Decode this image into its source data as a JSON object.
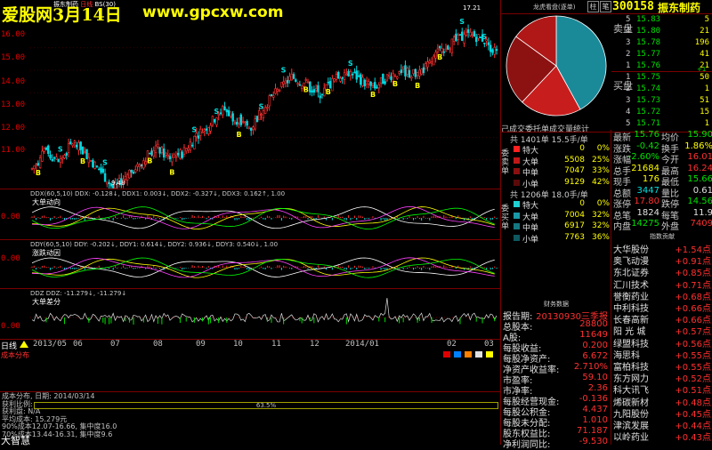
{
  "banner": {
    "site": "爱股网3月14日",
    "url": "www.gpcxw.com"
  },
  "chart_title": "振东制药",
  "chart_tag": "日线",
  "chart_sub": "BS(30)",
  "main_axis": [
    "16.00",
    "15.00",
    "14.00",
    "13.00",
    "12.00",
    "11.00"
  ],
  "price_labels": {
    "high": "17.21",
    "low": "9.48"
  },
  "ind1": {
    "header": "DDX(60,5,10)  DDX: -0.128↓, DDX1: 0.003↓, DDX2: -0.327↓, DDX3: 0.162↑, 1.00",
    "name": "大单动向",
    "axis": "0.00"
  },
  "ind2": {
    "header": "DDY(60,5,10)  DDY: -0.202↓, DDY1: 0.614↓, DDY2: 0.936↓, DDY3: 0.540↓, 1.00",
    "name": "涨跌动因",
    "axis": "0.00"
  },
  "ind3": {
    "header": "DDZ  DDZ: -11.279↓, -11.279↓",
    "name": "大单差分",
    "axis": "0.00"
  },
  "xaxis": [
    "2013/05",
    "06",
    "07",
    "08",
    "09",
    "10",
    "11",
    "12",
    "2014/01",
    "02",
    "03"
  ],
  "bottom_tabs": {
    "day": "日线",
    "cost": "成本分布"
  },
  "bottom_info": {
    "line1": "成本分布, 日期: 2014/03/14",
    "profit_label": "获利比例:",
    "profit_pct": "63.5%",
    "line3": "获利盘: N/A",
    "line4": "平均成本: 15.279元",
    "line5": "90%成本12.07-16.66, 集中度16.0",
    "line6": "70%成本13.44-16.31, 集中度9.6",
    "logo": "大智慧"
  },
  "right": {
    "tabs": [
      "龙虎看盘(逐单)",
      "柱",
      "笔"
    ],
    "code": "300158",
    "name": "振东制药",
    "pie_title": "己成交委托单成交量统计",
    "sell_side": "卖盘",
    "buy_side": "买盘",
    "sell_orders": [
      {
        "lv": "5",
        "price": "15.83",
        "vol": "5"
      },
      {
        "lv": "4",
        "price": "15.80",
        "vol": "21"
      },
      {
        "lv": "3",
        "price": "15.78",
        "vol": "196"
      },
      {
        "lv": "2",
        "price": "15.77",
        "vol": "41"
      },
      {
        "lv": "1",
        "price": "15.76",
        "vol": "21"
      }
    ],
    "buy_orders": [
      {
        "lv": "1",
        "price": "15.75",
        "vol": "50"
      },
      {
        "lv": "2",
        "price": "15.74",
        "vol": "1"
      },
      {
        "lv": "3",
        "price": "15.73",
        "vol": "51"
      },
      {
        "lv": "4",
        "price": "15.72",
        "vol": "15"
      },
      {
        "lv": "5",
        "price": "15.71",
        "vol": "1"
      }
    ],
    "sell_stats": {
      "header": "共 1401单 15.5手/单",
      "side": "委卖单",
      "rows": [
        {
          "label": "特大",
          "count": "0",
          "pct": "0%"
        },
        {
          "label": "大单",
          "count": "5508",
          "pct": "25%"
        },
        {
          "label": "中单",
          "count": "7047",
          "pct": "33%"
        },
        {
          "label": "小单",
          "count": "9129",
          "pct": "42%"
        }
      ]
    },
    "buy_stats": {
      "header": "共 1206单 18.0手/单",
      "side": "委买单",
      "rows": [
        {
          "label": "特大",
          "count": "0",
          "pct": "0%"
        },
        {
          "label": "大单",
          "count": "7004",
          "pct": "32%"
        },
        {
          "label": "中单",
          "count": "6917",
          "pct": "32%"
        },
        {
          "label": "小单",
          "count": "7763",
          "pct": "36%"
        }
      ]
    },
    "quote": [
      {
        "l1": "最新",
        "v1": "15.76",
        "l2": "均价",
        "v2": "15.90"
      },
      {
        "l1": "涨跌",
        "v1": "-0.42",
        "l2": "换手",
        "v2": "1.86%"
      },
      {
        "l1": "涨幅",
        "v1": "-2.60%",
        "l2": "今开",
        "v2": "16.01"
      },
      {
        "l1": "总手",
        "v1": "21684",
        "l2": "最高",
        "v2": "16.24"
      },
      {
        "l1": "现手",
        "v1": "176",
        "l2": "最低",
        "v2": "15.66"
      },
      {
        "l1": "总额",
        "v1": "3447",
        "l2": "量比",
        "v2": "0.61"
      },
      {
        "l1": "涨停",
        "v1": "17.80",
        "l2": "跌停",
        "v2": "14.56"
      },
      {
        "l1": "总笔",
        "v1": "1824",
        "l2": "每笔",
        "v2": "11.9"
      },
      {
        "l1": "内盘",
        "v1": "14275",
        "l2": "外盘",
        "v2": "7409"
      }
    ],
    "fin_title": "财务数据",
    "fin": [
      {
        "label": "报告期:",
        "value": "20130930三季报"
      },
      {
        "label": "总股本:",
        "value": "28800"
      },
      {
        "label": "A股:",
        "value": "11649"
      },
      {
        "label": "每股收益:",
        "value": "0.200"
      },
      {
        "label": "每股净资产:",
        "value": "6.672"
      },
      {
        "label": "净资产收益率:",
        "value": "2.710%"
      },
      {
        "label": "市盈率:",
        "value": "59.10"
      },
      {
        "label": "市净率:",
        "value": "2.36"
      },
      {
        "label": "每股经营现金:",
        "value": "-0.136"
      },
      {
        "label": "每股公积金:",
        "value": "4.437"
      },
      {
        "label": "每股未分配:",
        "value": "1.010"
      },
      {
        "label": "股东权益比:",
        "value": "71.187"
      },
      {
        "label": "净利润同比:",
        "value": "-9.530"
      }
    ],
    "idx_title": "指数贡献",
    "idx": [
      {
        "name": "大华股份",
        "value": "+1.54点"
      },
      {
        "name": "奥飞动漫",
        "value": "+0.91点"
      },
      {
        "name": "东北证券",
        "value": "+0.85点"
      },
      {
        "name": "汇川技术",
        "value": "+0.71点"
      },
      {
        "name": "誉衡药业",
        "value": "+0.68点"
      },
      {
        "name": "中利科技",
        "value": "+0.66点"
      },
      {
        "name": "长春高新",
        "value": "+0.66点"
      },
      {
        "name": "阳 光 城",
        "value": "+0.57点"
      },
      {
        "name": "绿盟科技",
        "value": "+0.56点"
      },
      {
        "name": "海思科",
        "value": "+0.55点"
      },
      {
        "name": "富柏科技",
        "value": "+0.55点"
      },
      {
        "name": "东方网力",
        "value": "+0.52点"
      },
      {
        "name": "科大讯飞",
        "value": "+0.51点"
      },
      {
        "name": "烯碳新材",
        "value": "+0.48点"
      },
      {
        "name": "九阳股份",
        "value": "+0.45点"
      },
      {
        "name": "津滨发展",
        "value": "+0.44点"
      },
      {
        "name": "以岭药业",
        "value": "+0.43点"
      }
    ]
  },
  "chart_data": [
    {
      "type": "candlestick",
      "title": "振东制药",
      "ylim": [
        10.0,
        17.5
      ],
      "x_range": [
        "2013/05",
        "2014/03"
      ],
      "close_trend": [
        10.6,
        11.4,
        10.9,
        11.8,
        11.2,
        10.5,
        9.7,
        10.4,
        10.9,
        11.6,
        11.1,
        11.3,
        12.1,
        12.6,
        13.3,
        12.8,
        12.4,
        13.4,
        14.1,
        14.7,
        14.4,
        13.9,
        14.5,
        15.0,
        14.6,
        14.2,
        14.7,
        15.0,
        14.8,
        15.2,
        16.0,
        16.3,
        16.6,
        16.4,
        15.76
      ],
      "high": 17.21,
      "low": 9.48
    },
    {
      "type": "pie",
      "title": "己成交委托单成交量统计",
      "slices": [
        {
          "label": "卖-大单",
          "value": 25
        },
        {
          "label": "卖-中单",
          "value": 33
        },
        {
          "label": "卖-小单",
          "value": 42
        },
        {
          "label": "买-大单",
          "value": 32
        },
        {
          "label": "买-中单",
          "value": 32
        },
        {
          "label": "买-小单",
          "value": 36
        }
      ]
    }
  ]
}
